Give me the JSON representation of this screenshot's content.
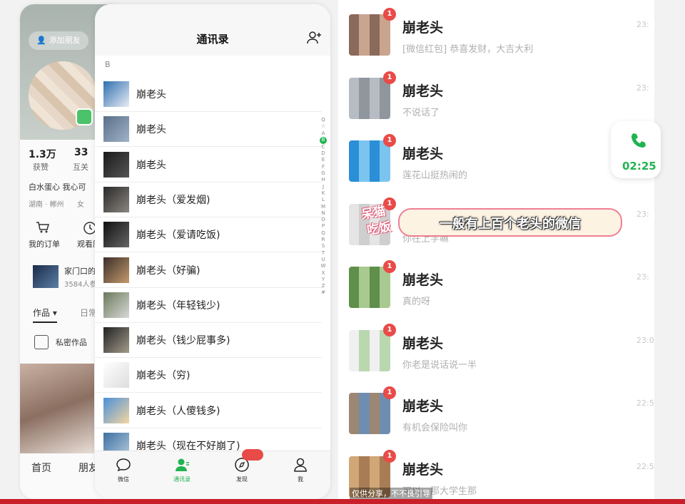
{
  "profile": {
    "add_friend": "添加朋友",
    "likes_num": "1.3万",
    "likes_label": "获赞",
    "mutual_num": "33",
    "mutual_label": "互关",
    "bio": "白水蛋心 我心可",
    "location": "湖南 · 郴州",
    "gender": "女",
    "orders_label": "我的订单",
    "history_label": "观看历",
    "group_title": "家门口的",
    "group_sub": "3584人参",
    "tab_works": "作品 ▾",
    "tab_daily": "日常",
    "private_works": "私密作品",
    "nav_home": "首页",
    "nav_friends": "朋友"
  },
  "contacts": {
    "title": "通讯录",
    "section": "B",
    "rows": [
      {
        "name": "崩老头",
        "colors": [
          "#2f6fb0",
          "#e9edf3"
        ]
      },
      {
        "name": "崩老头",
        "colors": [
          "#5a6f88",
          "#9fb2c8"
        ]
      },
      {
        "name": "崩老头",
        "colors": [
          "#1a1a1a",
          "#555555"
        ]
      },
      {
        "name": "崩老头（爱发烟)",
        "colors": [
          "#2a2a2a",
          "#8a8580"
        ]
      },
      {
        "name": "崩老头（爱请吃饭)",
        "colors": [
          "#111111",
          "#666666"
        ]
      },
      {
        "name": "崩老头（好骗)",
        "colors": [
          "#3b2f2a",
          "#c49a6c"
        ]
      },
      {
        "name": "崩老头（年轻钱少)",
        "colors": [
          "#6b7a5a",
          "#d9d9d9"
        ]
      },
      {
        "name": "崩老头（钱少屁事多)",
        "colors": [
          "#222222",
          "#a39c8c"
        ]
      },
      {
        "name": "崩老头（穷)",
        "colors": [
          "#ffffff",
          "#dddddd"
        ]
      },
      {
        "name": "崩老头（人傻钱多)",
        "colors": [
          "#4a90d9",
          "#f5d6a0"
        ]
      },
      {
        "name": "崩老头（现在不好崩了)",
        "colors": [
          "#3c6fa0",
          "#b8cde0"
        ]
      }
    ],
    "index_letters": [
      "Q",
      "☆",
      "A",
      "B",
      "C",
      "D",
      "E",
      "F",
      "G",
      "H",
      "J",
      "K",
      "L",
      "M",
      "N",
      "O",
      "P",
      "Q",
      "R",
      "S",
      "T",
      "U",
      "W",
      "X",
      "Y",
      "Z",
      "#"
    ],
    "index_active": "B",
    "tabs": [
      {
        "label": "微信",
        "icon": "chat-bubble-icon"
      },
      {
        "label": "通讯录",
        "icon": "contacts-icon"
      },
      {
        "label": "发现",
        "icon": "compass-icon"
      },
      {
        "label": "我",
        "icon": "person-icon"
      }
    ]
  },
  "chats": [
    {
      "name": "崩老头",
      "msg": "[微信红包] 恭喜发财，大吉大利",
      "time": "23:",
      "badge": "1",
      "colors": [
        "#8a6a5a",
        "#c9a48f"
      ]
    },
    {
      "name": "崩老头",
      "msg": "不说话了",
      "time": "23:",
      "badge": "1",
      "colors": [
        "#b7bcc2",
        "#8f969e"
      ]
    },
    {
      "name": "崩老头",
      "msg": "莲花山挺热闹的",
      "time": "",
      "badge": "1",
      "colors": [
        "#2a8fd6",
        "#7cc4f0"
      ]
    },
    {
      "name": "崩老头",
      "msg": "你在上学嘛",
      "time": "23:",
      "badge": "1",
      "colors": [
        "#e5e5e5",
        "#cfcfcf"
      ]
    },
    {
      "name": "崩老头",
      "msg": "真的呀",
      "time": "23:",
      "badge": "1",
      "colors": [
        "#5f8f4a",
        "#a8c98f"
      ]
    },
    {
      "name": "崩老头",
      "msg": "你老是说话说一半",
      "time": "23:0",
      "badge": "1",
      "colors": [
        "#f0f0f0",
        "#b9d8b0"
      ]
    },
    {
      "name": "崩老头",
      "msg": "有机会保险叫你",
      "time": "22:5",
      "badge": "1",
      "colors": [
        "#9c8774",
        "#6f8db0"
      ]
    },
    {
      "name": "崩老头",
      "msg": "可以，那大学生那",
      "time": "22:5",
      "badge": "1",
      "colors": [
        "#d1a777",
        "#a87c55"
      ]
    }
  ],
  "call": {
    "time": "02:25",
    "icon": "phone-icon"
  },
  "caption": {
    "logo_line1": "呆猫",
    "logo_line2": "吃饭",
    "text": "一般有上百个老头的微信"
  },
  "watermark": "仅供分享，不不良引导",
  "colors": {
    "wechat_green": "#21b350",
    "badge_red": "#e94b48",
    "stripe_red": "#c91f28"
  }
}
